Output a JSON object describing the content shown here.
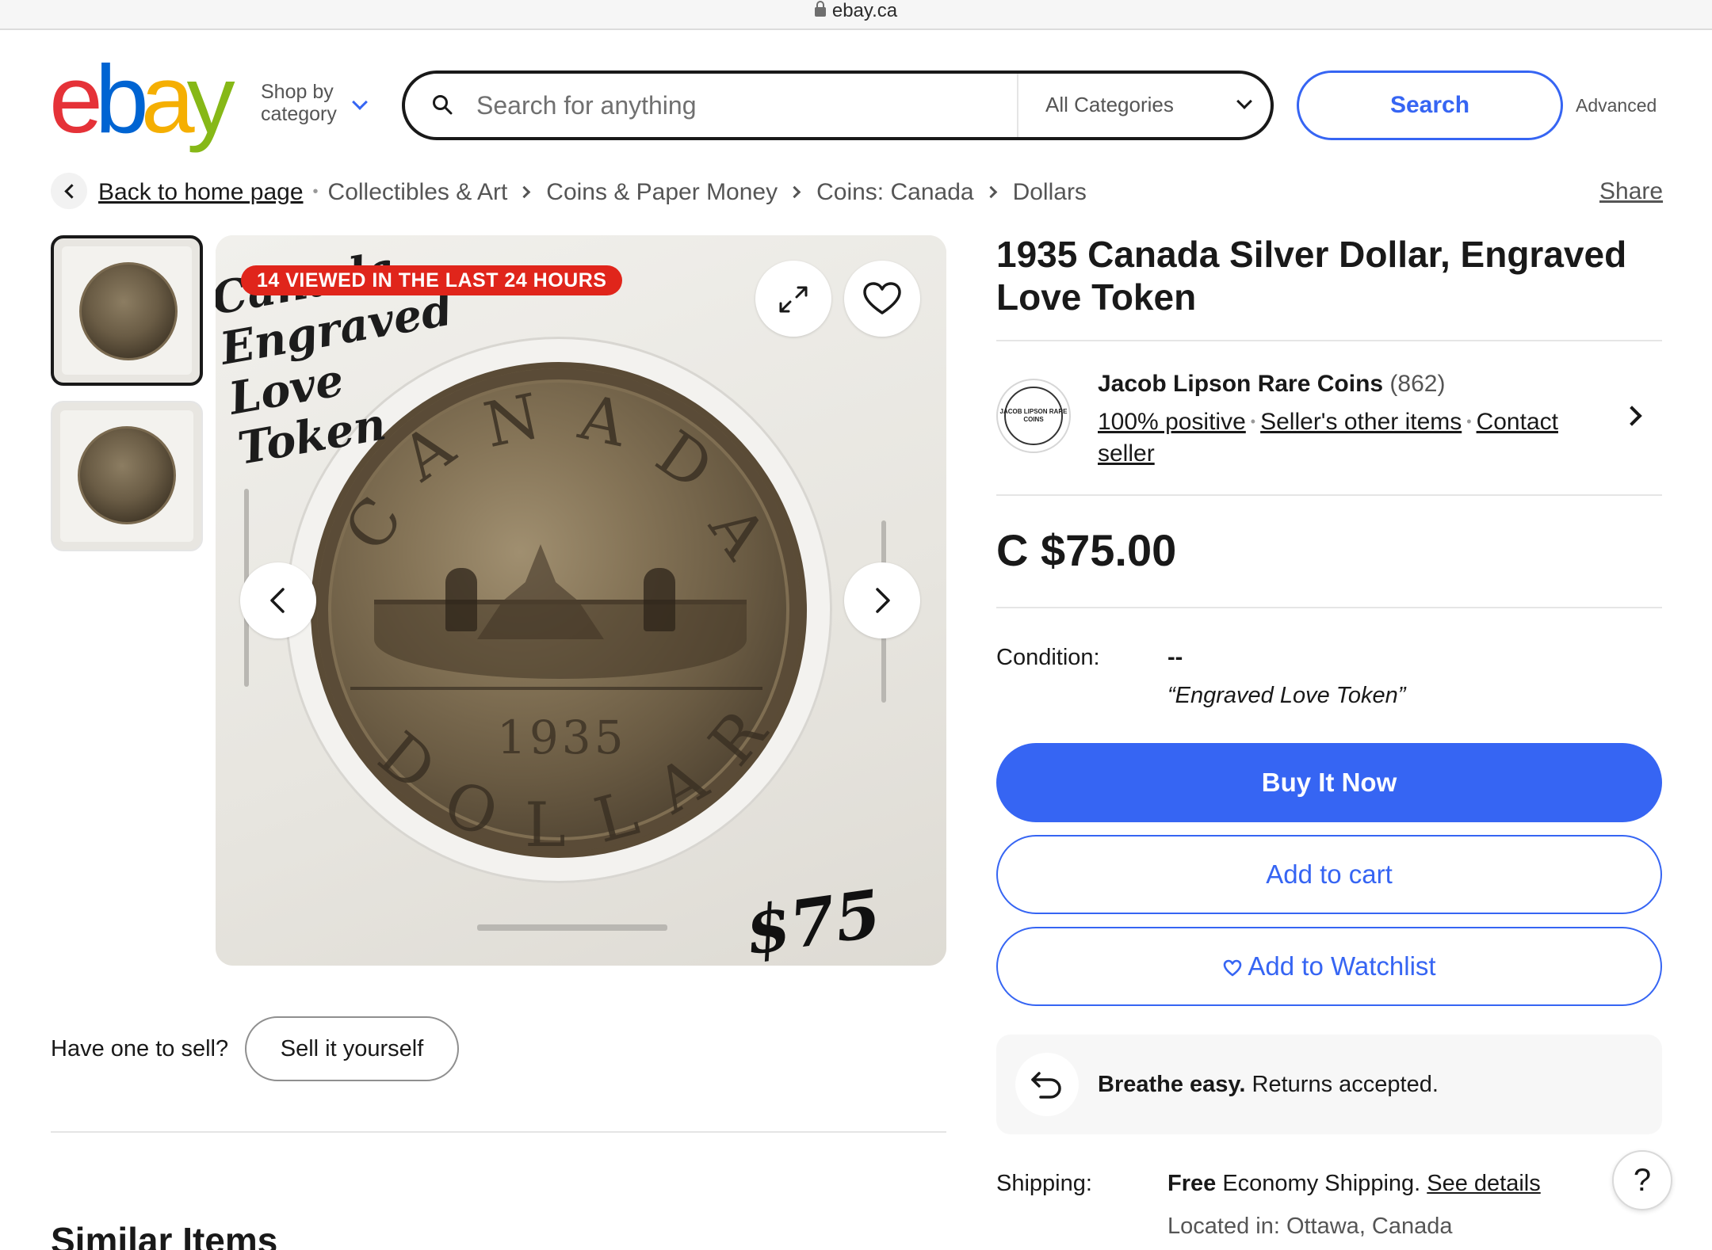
{
  "browser": {
    "url": "ebay.ca"
  },
  "header": {
    "logo": {
      "letters": [
        "e",
        "b",
        "a",
        "y"
      ],
      "colors": [
        "#e53238",
        "#0064d2",
        "#f5af02",
        "#86b817"
      ]
    },
    "shop_by_category": "Shop by category",
    "search": {
      "placeholder": "Search for anything",
      "value": "",
      "category": "All Categories"
    },
    "search_button": "Search",
    "advanced_link": "Advanced"
  },
  "breadcrumb": {
    "back_label": "Back to home page",
    "items": [
      "Collectibles & Art",
      "Coins & Paper Money",
      "Coins: Canada",
      "Dollars"
    ],
    "share": "Share"
  },
  "gallery": {
    "badge": "14 VIEWED IN THE LAST 24 HOURS",
    "handwritten_note": "Canada Engraved Love Token",
    "handwritten_price": "$75",
    "coin_year": "1935",
    "coin_inscription_top": "CANADA",
    "coin_inscription_bottom": "DOLLAR",
    "thumbnails": 2
  },
  "sell": {
    "question": "Have one to sell?",
    "button": "Sell it yourself"
  },
  "similar_heading": "Similar Items",
  "listing": {
    "title": "1935 Canada Silver Dollar, Engraved Love Token",
    "seller": {
      "name": "Jacob Lipson Rare Coins",
      "feedback_count": "(862)",
      "logo_text": "JACOB LIPSON RARE COINS",
      "positive": "100% positive",
      "other_items": "Seller's other items",
      "contact": "Contact seller"
    },
    "price": "C $75.00",
    "condition_label": "Condition:",
    "condition_value": "--",
    "condition_note": "“Engraved Love Token”",
    "buy_now": "Buy It Now",
    "add_to_cart": "Add to cart",
    "add_to_watchlist": "Add to Watchlist",
    "returns": {
      "bold": "Breathe easy.",
      "text": "Returns accepted."
    },
    "shipping_label": "Shipping:",
    "shipping": {
      "bold": "Free",
      "text": "Economy Shipping.",
      "link": "See details"
    },
    "located": "Located in: Ottawa, Canada",
    "help": "?"
  },
  "colors": {
    "accent": "#3665f3",
    "badge": "#e0251b",
    "text": "#191919",
    "muted": "#555555"
  }
}
